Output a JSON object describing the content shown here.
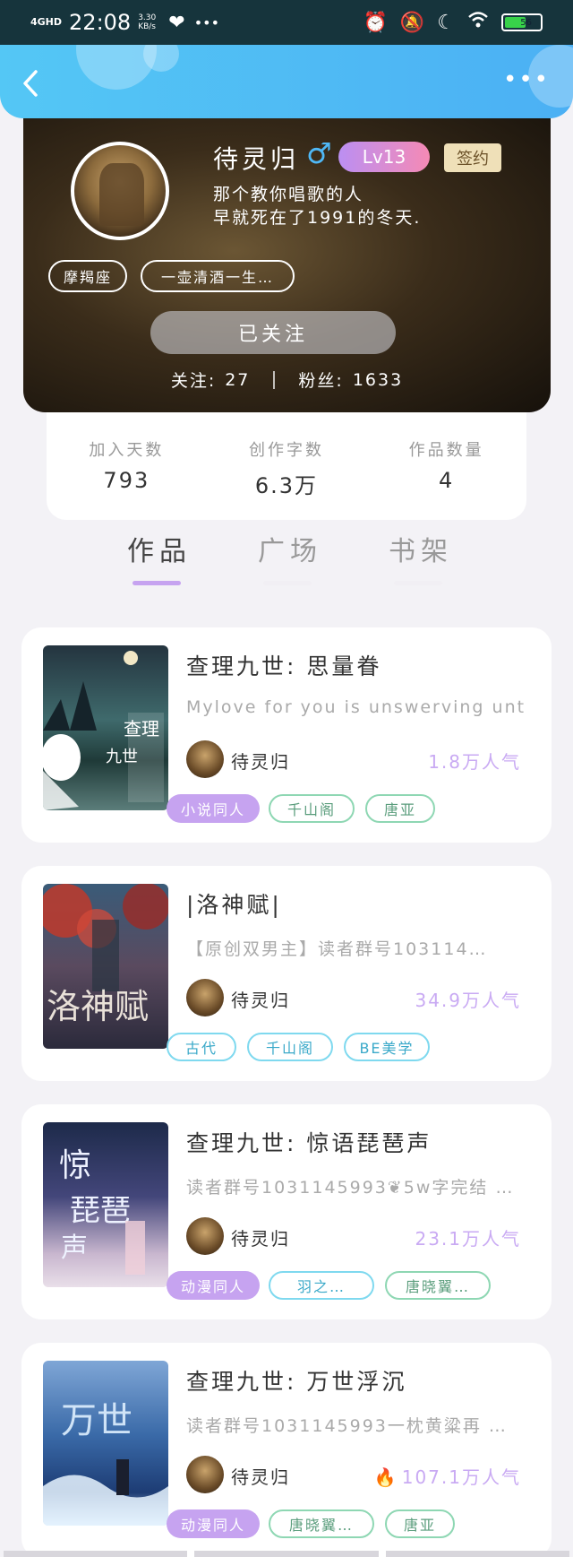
{
  "status_bar": {
    "network": "4GHD",
    "time": "22:08",
    "speed_value": "3.30",
    "speed_unit": "KB/s",
    "battery": "56",
    "icons": [
      "heart-icon",
      "more-dots-icon",
      "alarm-icon",
      "mute-icon",
      "moon-icon",
      "wifi-icon",
      "battery-icon"
    ]
  },
  "header": {
    "back_icon": "chevron-left-icon",
    "more_icon": "more-dots-icon",
    "back_label": "‹",
    "more_label": "•••"
  },
  "profile": {
    "username": "待灵归",
    "gender_symbol": "♂",
    "level": "Lv13",
    "sign_label": "签约",
    "bio_line1": "那个教你唱歌的人",
    "bio_line2": "早就死在了1991的冬天.",
    "tags": [
      "摩羯座",
      "一壶清酒一生…"
    ],
    "follow_button": "已关注",
    "following_label": "关注:",
    "following_count": "27",
    "fans_label": "粉丝:",
    "fans_count": "1633"
  },
  "stats": [
    {
      "label": "加入天数",
      "value": "793"
    },
    {
      "label": "创作字数",
      "value": "6.3万"
    },
    {
      "label": "作品数量",
      "value": "4"
    }
  ],
  "tabs": [
    {
      "label": "作品",
      "active": true
    },
    {
      "label": "广场",
      "active": false
    },
    {
      "label": "书架",
      "active": false
    }
  ],
  "works": [
    {
      "title": "查理九世: 思量眷",
      "desc": "Mylove for you is unswerving unti…",
      "author": "待灵归",
      "popularity": "1.8万人气",
      "tags": [
        {
          "text": "小说同人",
          "style": "fill-purple"
        },
        {
          "text": "千山阁",
          "style": "outline-green"
        },
        {
          "text": "唐亚",
          "style": "outline-green"
        }
      ]
    },
    {
      "title": "|洛神赋|",
      "desc": "【原创双男主】读者群号103114…",
      "author": "待灵归",
      "popularity": "34.9万人气",
      "tags": [
        {
          "text": "古代",
          "style": "outline-cyan"
        },
        {
          "text": "千山阁",
          "style": "outline-cyan"
        },
        {
          "text": "BE美学",
          "style": "outline-cyan"
        }
      ]
    },
    {
      "title": "查理九世: 惊语琵琶声",
      "desc": "读者群号1031145993❦5w字完结 …",
      "author": "待灵归",
      "popularity": "23.1万人气",
      "tags": [
        {
          "text": "动漫同人",
          "style": "fill-purple"
        },
        {
          "text": "羽之…",
          "style": "outline-cyan"
        },
        {
          "text": "唐晓翼…",
          "style": "outline-green"
        }
      ]
    },
    {
      "title": "查理九世: 万世浮沉",
      "desc": "读者群号1031145993一枕黄粱再 …",
      "author": "待灵归",
      "popularity": "107.1万人气",
      "hot": true,
      "tags": [
        {
          "text": "动漫同人",
          "style": "fill-purple"
        },
        {
          "text": "唐晓翼…",
          "style": "outline-green"
        },
        {
          "text": "唐亚",
          "style": "outline-green"
        }
      ]
    }
  ],
  "colors": {
    "status_bar": "#16343c",
    "header": "#4bb0f4",
    "accent_purple": "#c6a3f0",
    "popularity": "#c9aaf3"
  }
}
